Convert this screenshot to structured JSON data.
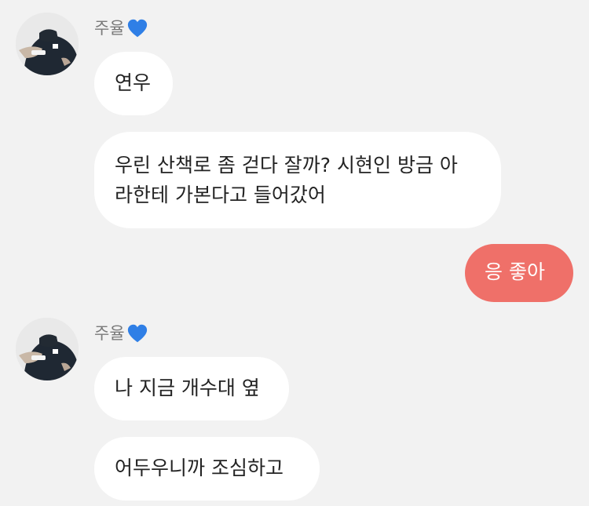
{
  "accent_out_color": "#ef7069",
  "heart_icon": "blue-heart",
  "groups": [
    {
      "sender_name": "주율",
      "messages": [
        "연우",
        "우린 산책로 좀 걷다 잘까? 시현인 방금 아",
        "라한테 가본다고 들어갔어"
      ]
    },
    {
      "mine": [
        "응 좋아"
      ]
    },
    {
      "sender_name": "주율",
      "messages": [
        "나 지금 개수대 옆",
        "어두우니까 조심하고"
      ]
    }
  ]
}
